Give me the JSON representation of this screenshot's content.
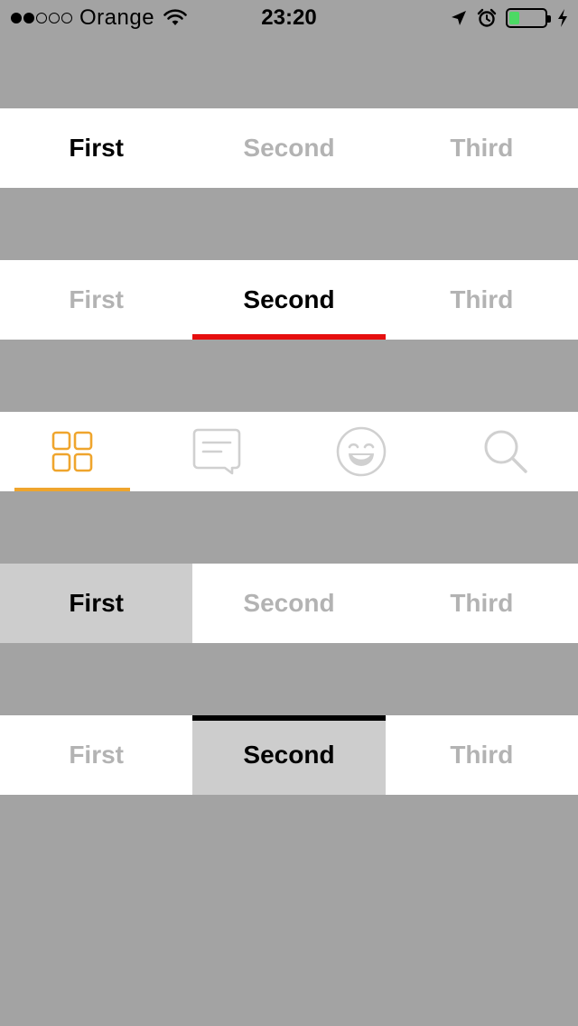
{
  "status_bar": {
    "carrier": "Orange",
    "time": "23:20",
    "signal_strength": 2,
    "signal_total": 5,
    "battery_level": 0.3
  },
  "tabbar1": {
    "tabs": [
      {
        "label": "First",
        "selected": true
      },
      {
        "label": "Second",
        "selected": false
      },
      {
        "label": "Third",
        "selected": false
      }
    ]
  },
  "tabbar2": {
    "tabs": [
      {
        "label": "First",
        "selected": false
      },
      {
        "label": "Second",
        "selected": true
      },
      {
        "label": "Third",
        "selected": false
      }
    ],
    "indicator_color": "#e60f0f"
  },
  "tabbar3": {
    "tabs": [
      {
        "icon": "grid-icon",
        "selected": true
      },
      {
        "icon": "message-icon",
        "selected": false
      },
      {
        "icon": "smiley-icon",
        "selected": false
      },
      {
        "icon": "search-icon",
        "selected": false
      }
    ],
    "accent_color": "#efa52d",
    "inactive_color": "#d0d0d0"
  },
  "tabbar4": {
    "tabs": [
      {
        "label": "First",
        "selected": true
      },
      {
        "label": "Second",
        "selected": false
      },
      {
        "label": "Third",
        "selected": false
      }
    ],
    "selected_background": "#cdcdcd"
  },
  "tabbar5": {
    "tabs": [
      {
        "label": "First",
        "selected": false
      },
      {
        "label": "Second",
        "selected": true
      },
      {
        "label": "Third",
        "selected": false
      }
    ],
    "selected_background": "#cdcdcd",
    "indicator_color": "#000000"
  },
  "colors": {
    "background": "#a3a3a3",
    "tab_background": "#ffffff",
    "text_selected": "#000000",
    "text_unselected": "#b3b3b3"
  }
}
